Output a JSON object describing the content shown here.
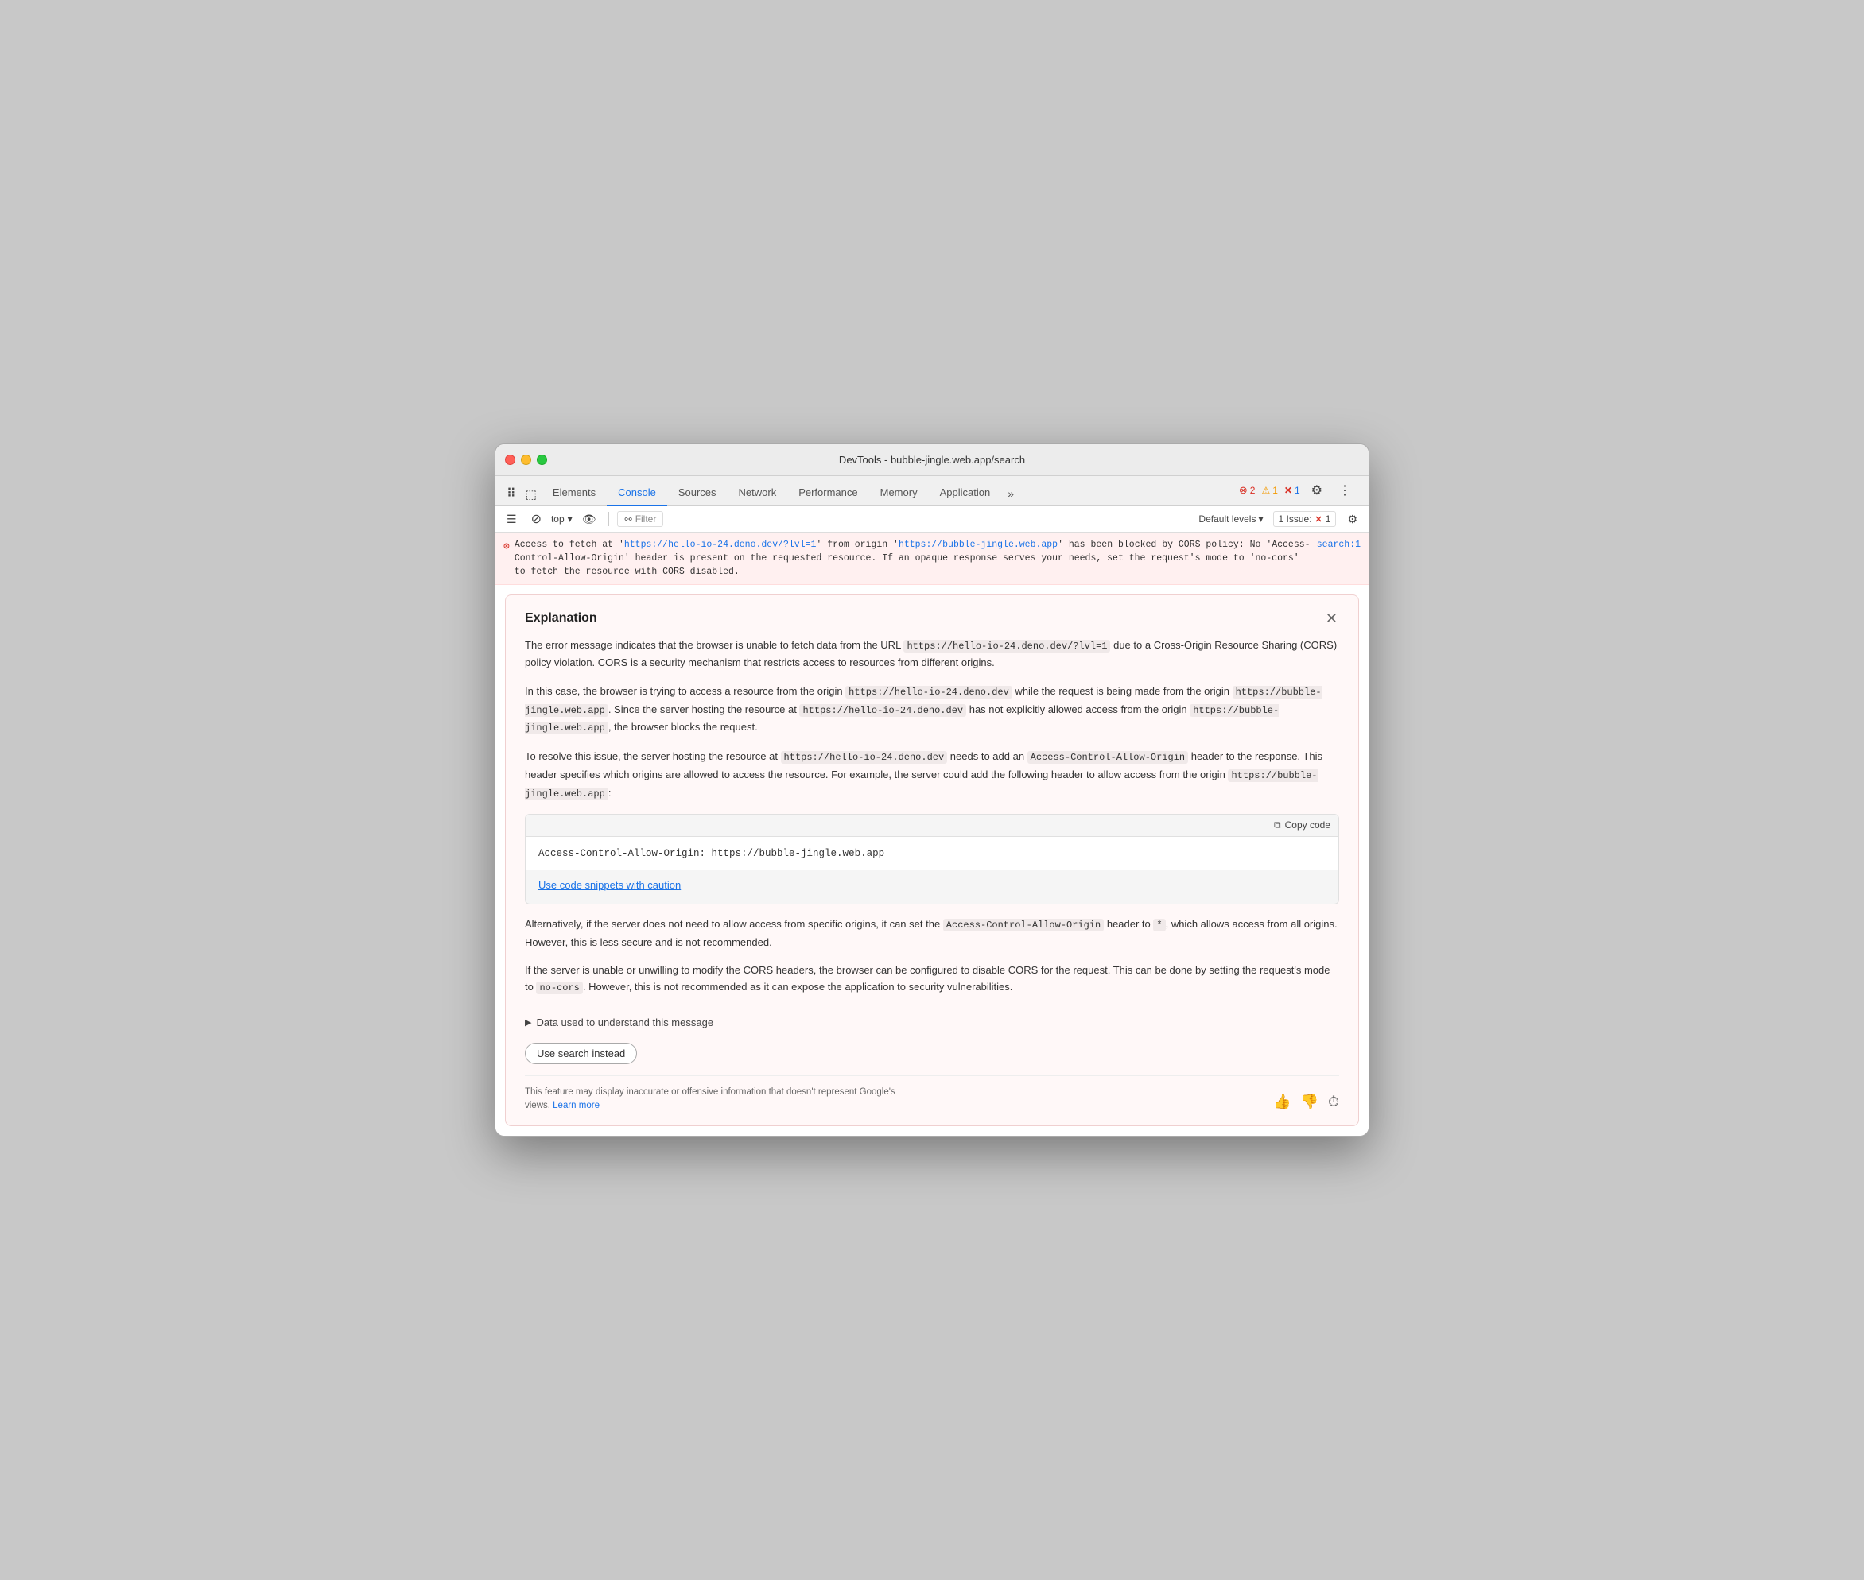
{
  "window": {
    "title": "DevTools - bubble-jingle.web.app/search"
  },
  "traffic_lights": {
    "red_label": "close",
    "yellow_label": "minimize",
    "green_label": "maximize"
  },
  "tabs": [
    {
      "label": "Elements",
      "active": false
    },
    {
      "label": "Console",
      "active": true
    },
    {
      "label": "Sources",
      "active": false
    },
    {
      "label": "Network",
      "active": false
    },
    {
      "label": "Performance",
      "active": false
    },
    {
      "label": "Memory",
      "active": false
    },
    {
      "label": "Application",
      "active": false
    }
  ],
  "subtoolbar": {
    "top_label": "top",
    "filter_label": "Filter",
    "default_levels_label": "Default levels",
    "issues_label": "1 Issue:",
    "issues_count": "1"
  },
  "badges": {
    "error_count": "2",
    "warn_count": "1",
    "info_count": "1"
  },
  "error_message": {
    "prefix": "Access to fetch at '",
    "url1": "https://hello-io-24.deno.dev/?lvl=1",
    "url1_href": "https://hello-io-24.deno.dev/?lvl=1",
    "middle": "' from origin '",
    "url2": "https://bubble-jingle.web.app",
    "url2_href": "https://bubble-jingle.web.app",
    "suffix": "' has been blocked by CORS policy: No 'Access-Control-Allow-Origin' header is present on the requested resource. If an opaque response serves your needs, set the request's mode to 'no-cors' to fetch the resource with CORS disabled.",
    "source_ref": "search:1"
  },
  "explanation": {
    "title": "Explanation",
    "para1": "The error message indicates that the browser is unable to fetch data from the URL",
    "para1_code1": "https://hello-io-24.deno.dev/?lvl=1",
    "para1_middle": "due to a Cross-Origin Resource Sharing (CORS) policy violation. CORS is a security mechanism that restricts access to resources from different origins.",
    "para2": "In this case, the browser is trying to access a resource from the origin",
    "para2_code1": "https://hello-io-24.deno.dev",
    "para2_middle": "while the request is being made from the origin",
    "para2_code2": "https://bubble-jingle.web.app",
    "para2_end1": ". Since the server hosting the resource at",
    "para2_code3": "https://hello-io-24.deno.dev",
    "para2_end2": "has not explicitly allowed access from the origin",
    "para2_code4": "https://bubble-jingle.web.app",
    "para2_end3": ", the browser blocks the request.",
    "para3_start": "To resolve this issue, the server hosting the resource at",
    "para3_code1": "https://hello-io-24.deno.dev",
    "para3_middle": "needs to add an",
    "para3_code2": "Access-Control-Allow-Origin",
    "para3_end": "header to the response. This header specifies which origins are allowed to access the resource. For example, the server could add the following header to allow access from the origin",
    "para3_code3": "https://bubble-jingle.web.app",
    "para3_colon": ":",
    "copy_code_label": "Copy code",
    "code_snippet": "Access-Control-Allow-Origin: https://bubble-jingle.web.app",
    "caution_link": "Use code snippets with caution",
    "para4": "Alternatively, if the server does not need to allow access from specific origins, it can set the",
    "para4_code1": "Access-Control-Allow-Origin",
    "para4_middle": "header to",
    "para4_code2": "*",
    "para4_end": ", which allows access from all origins. However, this is less secure and is not recommended.",
    "para5_start": "If the server is unable or unwilling to modify the CORS headers, the browser can be configured to disable CORS for the request. This can be done by setting the request's mode to",
    "para5_code1": "no-cors",
    "para5_end": ". However, this is not recommended as it can expose the application to security vulnerabilities.",
    "data_used_label": "Data used to understand this message",
    "use_search_label": "Use search instead",
    "disclaimer_text": "This feature may display inaccurate or offensive information that doesn't represent Google's views.",
    "learn_more_label": "Learn more"
  }
}
